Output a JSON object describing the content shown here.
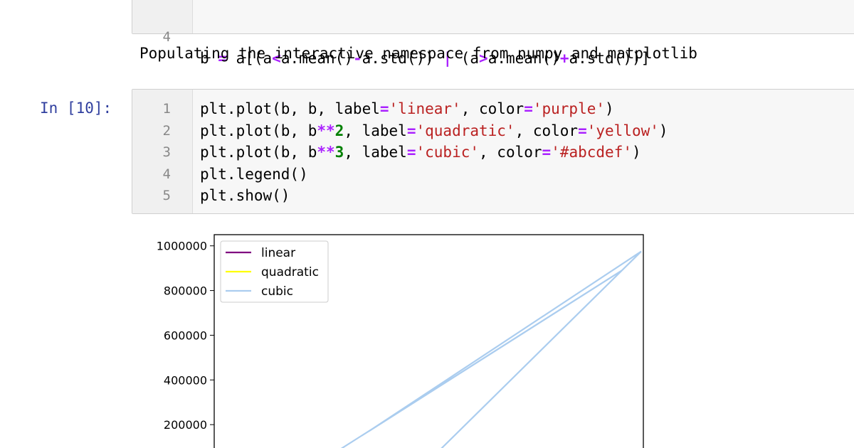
{
  "cell_top": {
    "line_number": "4",
    "code_tokens": [
      {
        "t": "b ",
        "c": ""
      },
      {
        "t": "=",
        "c": "op"
      },
      {
        "t": " a[(a",
        "c": ""
      },
      {
        "t": "<",
        "c": "op"
      },
      {
        "t": "a.mean()",
        "c": ""
      },
      {
        "t": "-",
        "c": "op"
      },
      {
        "t": "a.std()) ",
        "c": ""
      },
      {
        "t": "|",
        "c": "op"
      },
      {
        "t": " (a",
        "c": ""
      },
      {
        "t": ">",
        "c": "op"
      },
      {
        "t": "a.mean()",
        "c": ""
      },
      {
        "t": "+",
        "c": "op"
      },
      {
        "t": "a.std())]",
        "c": ""
      }
    ]
  },
  "output_text": "Populating the interactive namespace from numpy and matplotlib",
  "cell_main": {
    "prompt": "In [10]:",
    "lines": [
      {
        "num": "1",
        "tokens": [
          {
            "t": "plt.plot(b, b, label",
            "c": ""
          },
          {
            "t": "=",
            "c": "op"
          },
          {
            "t": "'linear'",
            "c": "str"
          },
          {
            "t": ", color",
            "c": ""
          },
          {
            "t": "=",
            "c": "op"
          },
          {
            "t": "'purple'",
            "c": "str"
          },
          {
            "t": ")",
            "c": ""
          }
        ]
      },
      {
        "num": "2",
        "tokens": [
          {
            "t": "plt.plot(b, b",
            "c": ""
          },
          {
            "t": "**",
            "c": "op"
          },
          {
            "t": "2",
            "c": "num"
          },
          {
            "t": ", label",
            "c": ""
          },
          {
            "t": "=",
            "c": "op"
          },
          {
            "t": "'quadratic'",
            "c": "str"
          },
          {
            "t": ", color",
            "c": ""
          },
          {
            "t": "=",
            "c": "op"
          },
          {
            "t": "'yellow'",
            "c": "str"
          },
          {
            "t": ")",
            "c": ""
          }
        ]
      },
      {
        "num": "3",
        "tokens": [
          {
            "t": "plt.plot(b, b",
            "c": ""
          },
          {
            "t": "**",
            "c": "op"
          },
          {
            "t": "3",
            "c": "num"
          },
          {
            "t": ", label",
            "c": ""
          },
          {
            "t": "=",
            "c": "op"
          },
          {
            "t": "'cubic'",
            "c": "str"
          },
          {
            "t": ", color",
            "c": ""
          },
          {
            "t": "=",
            "c": "op"
          },
          {
            "t": "'#abcdef'",
            "c": "str"
          },
          {
            "t": ")",
            "c": ""
          }
        ]
      },
      {
        "num": "4",
        "tokens": [
          {
            "t": "plt.legend()",
            "c": ""
          }
        ]
      },
      {
        "num": "5",
        "tokens": [
          {
            "t": "plt.show()",
            "c": ""
          }
        ]
      }
    ]
  },
  "chart_data": {
    "type": "line",
    "ylim": [
      0,
      1050000
    ],
    "y_ticks": [
      {
        "value": 200000,
        "label": "200000"
      },
      {
        "value": 400000,
        "label": "400000"
      },
      {
        "value": 600000,
        "label": "600000"
      },
      {
        "value": 800000,
        "label": "800000"
      },
      {
        "value": 1000000,
        "label": "1000000"
      }
    ],
    "legend": {
      "position": "upper left",
      "entries": [
        {
          "label": "linear",
          "color": "#800080"
        },
        {
          "label": "quadratic",
          "color": "#ffff00"
        },
        {
          "label": "cubic",
          "color": "#abcdef"
        }
      ]
    },
    "series": [
      {
        "name": "cubic",
        "color": "#abcdef",
        "points": [
          [
            0.22,
            0
          ],
          [
            0.95,
            890000
          ],
          [
            0.36,
            170000
          ],
          [
            0.995,
            975000
          ],
          [
            0.48,
            0
          ]
        ]
      }
    ]
  }
}
